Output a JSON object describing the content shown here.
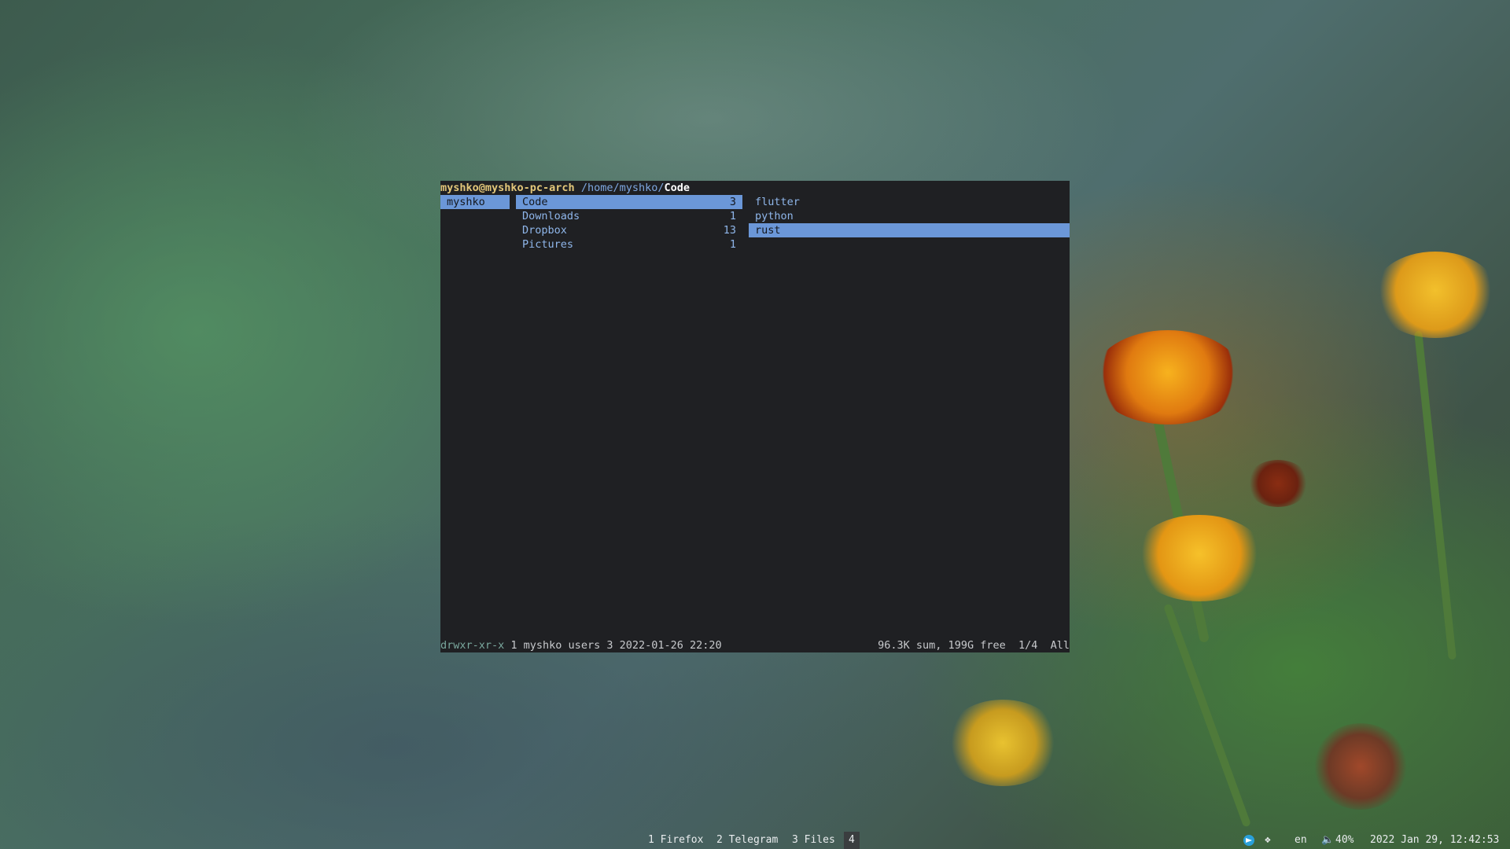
{
  "terminal": {
    "title_user": "myshko@myshko-pc-arch",
    "title_path": "/home/myshko/",
    "title_current": "Code",
    "parent_column": [
      {
        "name": "myshko"
      }
    ],
    "current_column": [
      {
        "name": "Code",
        "count": "3"
      },
      {
        "name": "Downloads",
        "count": "1"
      },
      {
        "name": "Dropbox",
        "count": "13"
      },
      {
        "name": "Pictures",
        "count": "1"
      }
    ],
    "preview_column": [
      {
        "name": "flutter"
      },
      {
        "name": "python"
      },
      {
        "name": "rust"
      }
    ],
    "status_permissions": "drwxr-xr-x",
    "status_info": " 1 myshko users 3 2022-01-26 22:20",
    "status_disk": "96.3K sum, 199G free  1/4  All"
  },
  "panel": {
    "workspaces": [
      "1 Firefox",
      "2 Telegram",
      "3 Files",
      "4"
    ],
    "icons": [
      "telegram-icon",
      "dropbox-icon",
      "volume-icon"
    ],
    "keyboard_layout": "en",
    "volume": "40%",
    "clock": "2022 Jan 29, 12:42:53"
  }
}
